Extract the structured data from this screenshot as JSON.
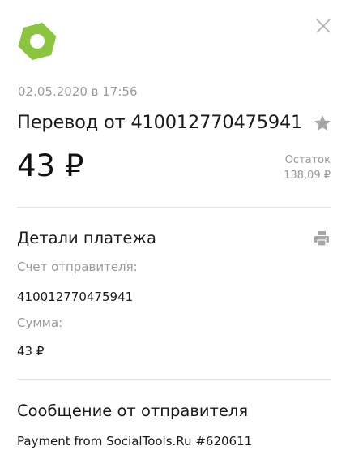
{
  "brand": {
    "logo_icon": "yoomoney-hexagon-logo-icon",
    "logo_color": "#8bc53f"
  },
  "header": {
    "close_icon": "close-icon"
  },
  "transaction": {
    "datetime": "02.05.2020 в 17:56",
    "title": "Перевод от 410012770475941",
    "favorite_icon": "star-icon",
    "amount": "43 ₽",
    "balance_label": "Остаток",
    "balance_value": "138,09 ₽"
  },
  "details": {
    "title": "Детали платежа",
    "print_icon": "printer-icon",
    "sender_account_label": "Счет отправителя:",
    "sender_account_value": "410012770475941",
    "sum_label": "Сумма:",
    "sum_value": "43 ₽"
  },
  "message": {
    "title": "Сообщение от отправителя",
    "text": "Payment from SocialTools.Ru #620611"
  },
  "colors": {
    "muted_text": "#9a9a9a",
    "divider": "#e3e3e3",
    "icon_gray": "#a6a6a6"
  }
}
